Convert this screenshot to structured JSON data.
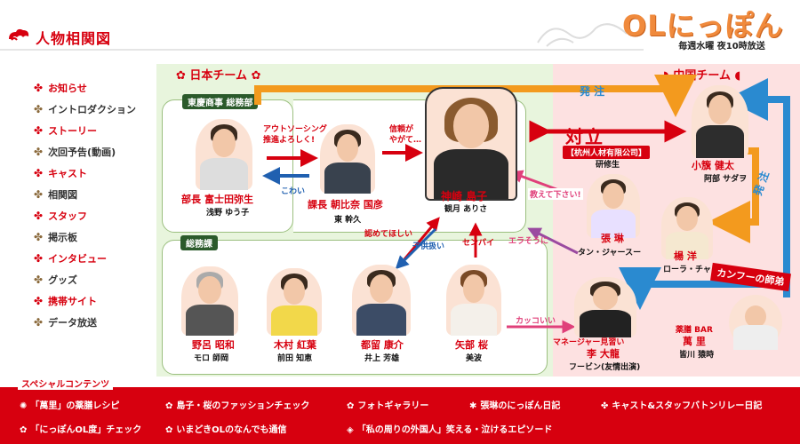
{
  "header": {
    "title": "人物相関図",
    "show_logo": "OLにっぽん",
    "schedule": "毎週水曜 夜10時放送"
  },
  "sidebar": {
    "items": [
      {
        "label": "お知らせ"
      },
      {
        "label": "イントロダクション"
      },
      {
        "label": "ストーリー"
      },
      {
        "label": "次回予告(動画)"
      },
      {
        "label": "キャスト"
      },
      {
        "label": "相関図"
      },
      {
        "label": "スタッフ"
      },
      {
        "label": "掲示板"
      },
      {
        "label": "インタビュー"
      },
      {
        "label": "グッズ"
      },
      {
        "label": "携帯サイト"
      },
      {
        "label": "データ放送"
      }
    ]
  },
  "japan_team": {
    "header": "日本チーム",
    "general_affairs_dept": "東慶商事 総務部",
    "general_affairs_section": "総務課"
  },
  "china_team": {
    "header": "中国チーム",
    "faceoff": "対立",
    "company": "【杭州人材有限公司】",
    "trainee": "研修生"
  },
  "characters": {
    "fujita": {
      "role": "部長",
      "name": "富士田弥生",
      "actor": "浅野 ゆう子"
    },
    "asahina": {
      "role": "課長",
      "name": "朝比奈 国彦",
      "actor": "東 幹久"
    },
    "kanzaki": {
      "name": "神崎 島子",
      "actor": "観月 ありさ"
    },
    "kohata": {
      "name": "小籏 健太",
      "actor": "阿部 サダヲ"
    },
    "zhang": {
      "name": "張 琳",
      "actor": "タン・ジャースー"
    },
    "yang": {
      "name": "楊 洋",
      "actor": "ローラ・チャン"
    },
    "noro": {
      "name": "野呂 昭和",
      "actor": "モロ 師岡"
    },
    "kimura": {
      "name": "木村 紅葉",
      "actor": "前田 知恵"
    },
    "tsuru": {
      "name": "都留 康介",
      "actor": "井上 芳雄"
    },
    "yabe": {
      "name": "矢部 桜",
      "actor": "美波"
    },
    "li": {
      "title": "マネージャー見習い",
      "name": "李 大龍",
      "actor": "フービン(友情出演)"
    },
    "manri": {
      "title": "薬膳 BAR",
      "name": "萬 里",
      "actor": "皆川 猿時"
    }
  },
  "relations": {
    "outsourcing": "アウトソーシング",
    "outsourcing_2": "推進よろしく!",
    "scary": "こわい",
    "trust": "信頼が",
    "trust_2": "やがて…",
    "order_1": "発 注",
    "order_2": "発 注",
    "please_teach": "教えて下さい!",
    "arrogant": "エラそうに",
    "acknowledge": "認めてほしい",
    "childish": "子供扱い",
    "senpai": "センパイ",
    "cool": "カッコいい",
    "kungfu_master": "カンフーの師弟"
  },
  "special": {
    "heading": "スペシャルコンテンツ",
    "links": [
      {
        "label": "「萬里」の薬膳レシピ"
      },
      {
        "label": "島子・桜のファッションチェック"
      },
      {
        "label": "フォトギャラリー"
      },
      {
        "label": "張琳のにっぽん日記"
      },
      {
        "label": "キャスト&スタッフバトンリレー日記"
      },
      {
        "label": "「にっぽんOL度」チェック"
      },
      {
        "label": "いまどきOLのなんでも通信"
      },
      {
        "label": "「私の周りの外国人」笑える・泣けるエピソード"
      }
    ]
  },
  "colors": {
    "accent": "#d7000f",
    "japan_bg": "#e8f5dd",
    "china_bg": "#fde1e1",
    "order_blue": "#2a8ad0",
    "arrow_orange": "#f39a1e"
  }
}
